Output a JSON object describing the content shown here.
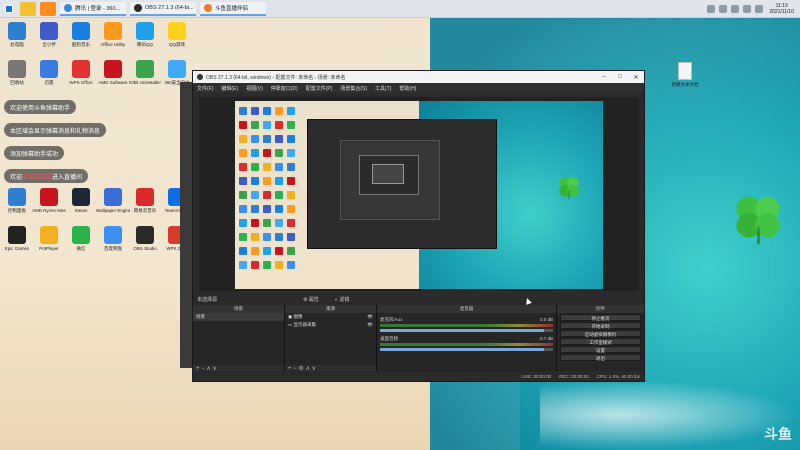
{
  "taskbar": {
    "tabs": [
      {
        "label": "腾讯 | 登录 - 360...",
        "color": "#3b87d9"
      },
      {
        "label": "OBS 27.1.3 (64-bi...",
        "color": "#2a2a2a"
      },
      {
        "label": "斗鱼直播伴侣",
        "color": "#f0772b"
      }
    ],
    "time": "11:19",
    "date": "2021/11/10"
  },
  "desktop": {
    "icons": [
      {
        "label": "此电脑",
        "color": "#2f7fd1"
      },
      {
        "label": "全小伴",
        "color": "#3e5bc9"
      },
      {
        "label": "酷狗音乐",
        "color": "#1b7fe0"
      },
      {
        "label": "Office Utility",
        "color": "#ff9a1f"
      },
      {
        "label": "腾讯QQ",
        "color": "#1fa0ea"
      },
      {
        "label": "QQ游戏",
        "color": "#ffd21c"
      },
      {
        "label": "回收站",
        "color": "#777777"
      },
      {
        "label": "迅雷",
        "color": "#3a7be0"
      },
      {
        "label": "WPS Office",
        "color": "#e2312f"
      },
      {
        "label": "AMD Software",
        "color": "#c4161c"
      },
      {
        "label": "IObit Uninstaller",
        "color": "#3ba34c"
      },
      {
        "label": "360安全卫士",
        "color": "#40a9f5"
      },
      {
        "label": "控制面板",
        "color": "#2f7fd1"
      },
      {
        "label": "AMD Ryzen Master",
        "color": "#c4161c"
      },
      {
        "label": "Steam",
        "color": "#1b2838"
      },
      {
        "label": "Wallpaper Engine",
        "color": "#3b6dd8"
      },
      {
        "label": "网易云音乐",
        "color": "#d92b2b"
      },
      {
        "label": "TeamViewer",
        "color": "#0e6ee8"
      },
      {
        "label": "Epic Games",
        "color": "#222222"
      },
      {
        "label": "PotPlayer",
        "color": "#f2b021"
      },
      {
        "label": "微信",
        "color": "#2bb24c"
      },
      {
        "label": "百度网盘",
        "color": "#3a8ff0"
      },
      {
        "label": "OBS Studio",
        "color": "#2a2a2a"
      },
      {
        "label": "WPS 2019",
        "color": "#d93b2b"
      }
    ],
    "right_file": "新建文本文档"
  },
  "chat": {
    "line1": "欢迎使用斗鱼弹幕助手",
    "line2": "本区域会显示弹幕消息和礼物消息",
    "line3": "添加弹幕助手成功",
    "line4_pre": "欢迎",
    "line4_name": "某某某某某",
    "line4_post": "进入直播间"
  },
  "obs": {
    "title": "OBS 27.1.3 (64-bit, windows) - 配置文件: 未命名 - 场景: 未命名",
    "menu": [
      "文件(F)",
      "编辑(E)",
      "视图(V)",
      "停靠窗口(D)",
      "配置文件(P)",
      "场景集合(S)",
      "工具(T)",
      "帮助(H)"
    ],
    "toolbar": {
      "source_none": "未选择源",
      "properties": "属性",
      "filters": "滤镜"
    },
    "docks": {
      "scenes": {
        "title": "场景",
        "items": [
          "场景"
        ]
      },
      "sources": {
        "title": "来源",
        "items": [
          "图像",
          "显示器采集"
        ]
      },
      "mixer": {
        "title": "混音器",
        "channels": [
          {
            "name": "麦克风/Aux",
            "db": "0.0 dB",
            "level": 0.55,
            "volume": 0.95
          },
          {
            "name": "桌面音频",
            "db": "-3.7 dB",
            "level": 0.5,
            "volume": 0.95
          }
        ]
      },
      "controls": {
        "title": "控件",
        "buttons": [
          "停止推流",
          "开始录制",
          "启动虚拟摄像机",
          "工作室模式",
          "设置",
          "退出"
        ]
      }
    },
    "status": {
      "live": "LIVE: 00:00:00",
      "rec": "REC: 00:00:00",
      "cpu": "CPU: 1.3%, 60.00 fps"
    }
  },
  "watermark": "斗鱼"
}
